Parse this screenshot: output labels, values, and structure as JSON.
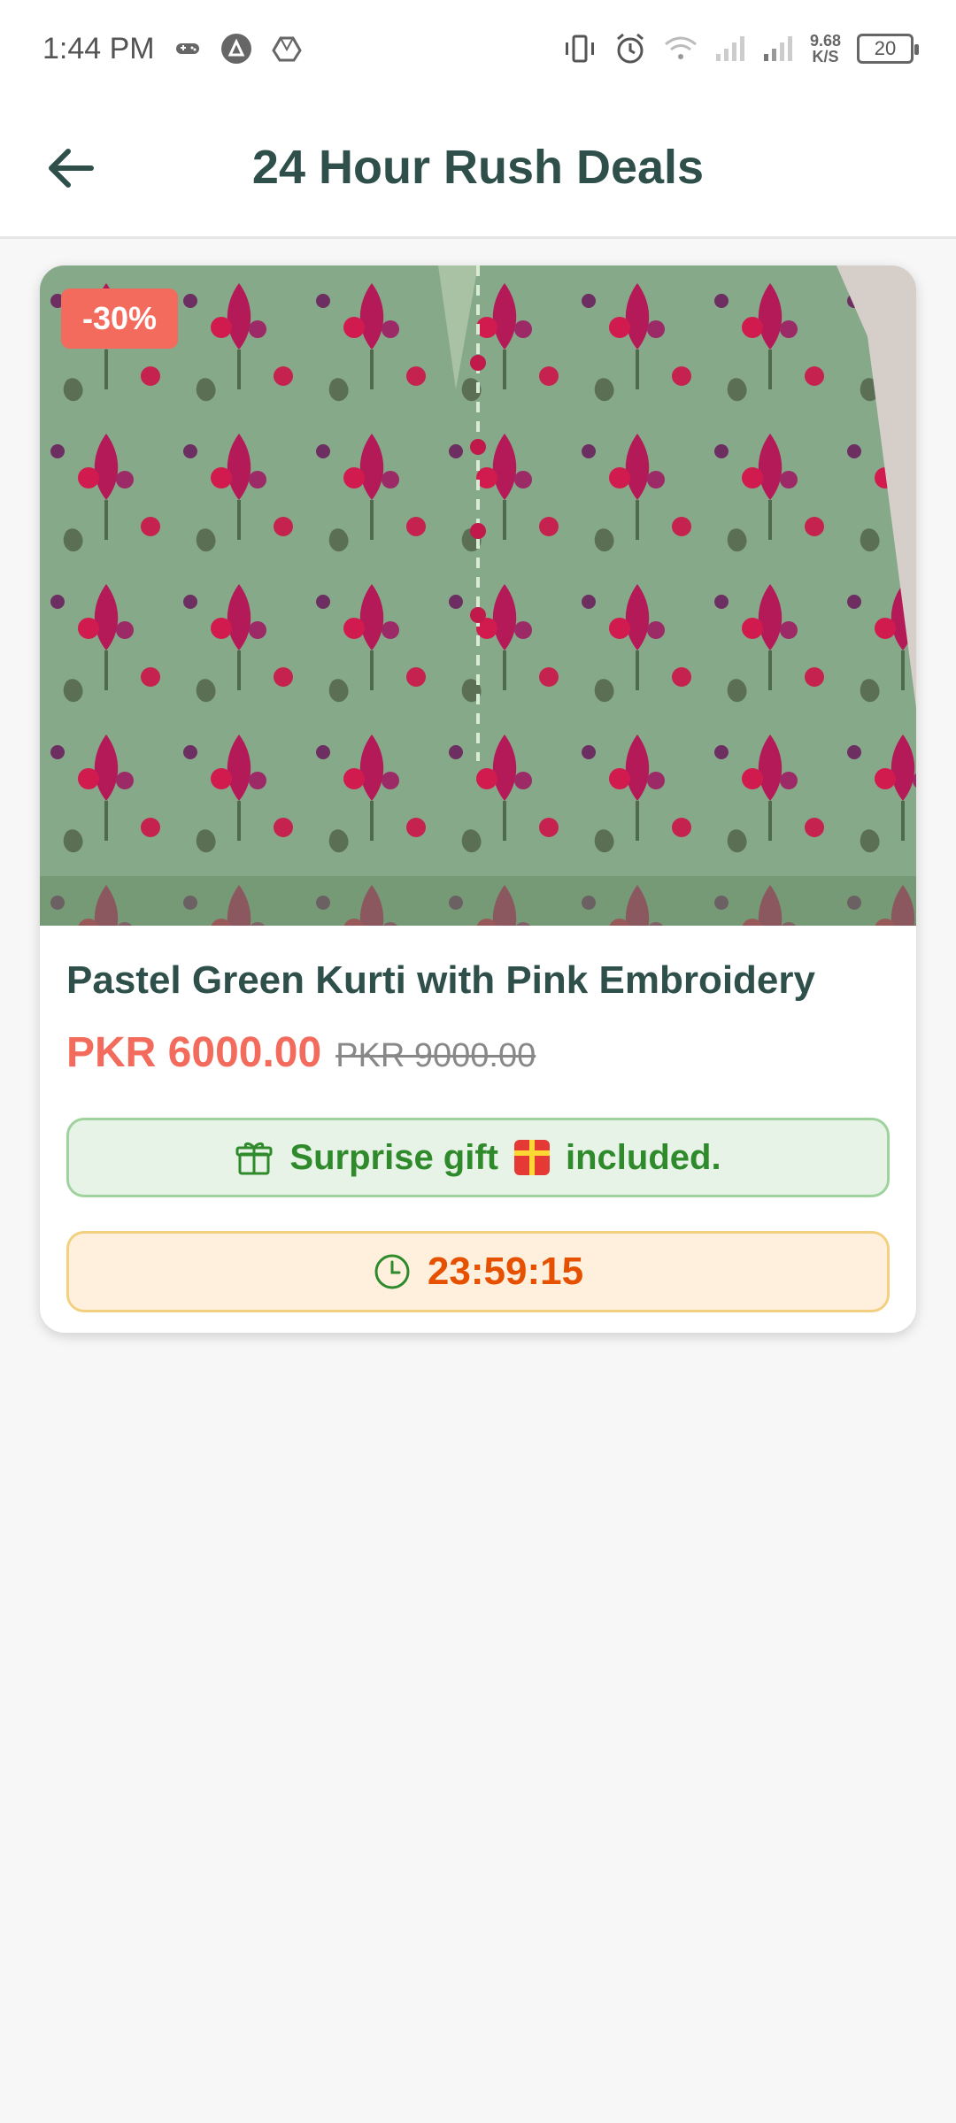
{
  "status_bar": {
    "time": "1:44 PM",
    "speed_value": "9.68",
    "speed_unit": "K/S",
    "battery": "20"
  },
  "header": {
    "title": "24 Hour Rush Deals",
    "back_icon": "arrow-left-icon"
  },
  "deal": {
    "discount_badge": "-30%",
    "title": "Pastel Green Kurti with Pink Embroidery",
    "price": "PKR 6000.00",
    "original_price": "PKR 9000.00",
    "gift_text_prefix": "Surprise gift",
    "gift_text_suffix": "included.",
    "countdown": "23:59:15"
  },
  "colors": {
    "accent": "#2f4f4a",
    "price": "#f36b5c",
    "gift_green": "#2f8a2c",
    "timer_orange": "#e65100"
  }
}
